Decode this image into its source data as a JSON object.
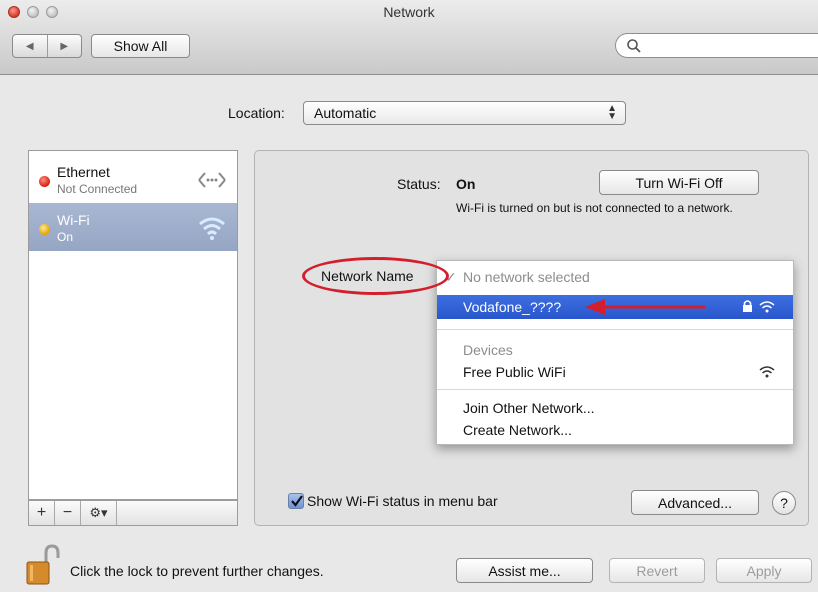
{
  "window": {
    "title": "Network"
  },
  "toolbar": {
    "back": "◀",
    "forward": "▶",
    "show_all": "Show All",
    "search_placeholder": ""
  },
  "location": {
    "label": "Location:",
    "value": "Automatic"
  },
  "sidebar": {
    "items": [
      {
        "name": "Ethernet",
        "status": "Not Connected",
        "dot_color": "#d2200f",
        "icon": "ethernet-icon"
      },
      {
        "name": "Wi-Fi",
        "status": "On",
        "dot_color": "#e3a400",
        "icon": "wifi-icon"
      }
    ],
    "bottom": {
      "add": "+",
      "remove": "−",
      "gear": "⚙▾"
    }
  },
  "detail": {
    "status_label": "Status:",
    "status_value": "On",
    "turn_off_button": "Turn Wi-Fi Off",
    "status_desc": "Wi-Fi is turned on but is not connected to a network.",
    "network_name_label": "Network Name"
  },
  "network_menu": {
    "no_network": "No network selected",
    "networks": [
      {
        "name": "Vodafone_????",
        "locked": true
      }
    ],
    "devices_header": "Devices",
    "devices": [
      {
        "name": "Free Public WiFi"
      }
    ],
    "join_other": "Join Other Network...",
    "create": "Create Network..."
  },
  "bottom": {
    "show_status_checkbox": "Show Wi-Fi status in menu bar",
    "advanced_button": "Advanced...",
    "help_button": "?",
    "lock_text": "Click the lock to prevent further changes.",
    "assist_button": "Assist me...",
    "revert_button": "Revert",
    "apply_button": "Apply"
  },
  "colors": {
    "highlight": "#2956cc",
    "annotation_red": "#d21f2b",
    "selected_row": "#95a6c4"
  }
}
